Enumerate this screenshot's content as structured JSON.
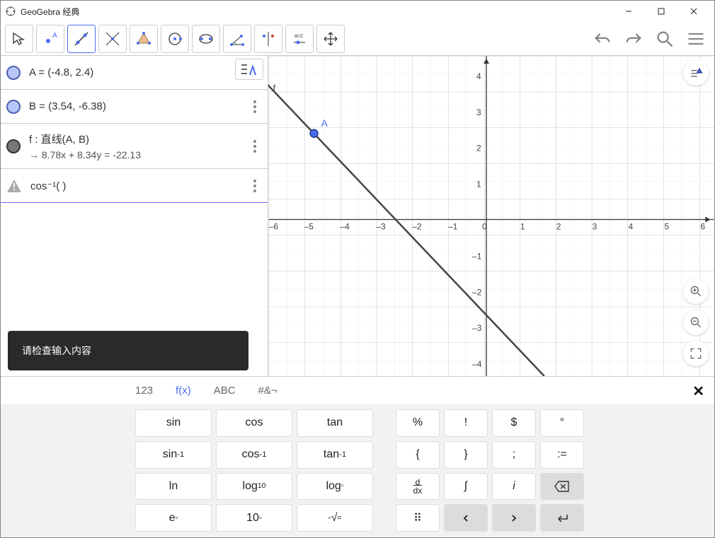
{
  "window": {
    "title": "GeoGebra 经典"
  },
  "algebra": {
    "rows": [
      {
        "label": "A = (-4.8, 2.4)"
      },
      {
        "label": "B = (3.54, -6.38)"
      },
      {
        "label": "f : 直线(A, B)",
        "sub": "→  8.78x + 8.34y = -22.13"
      },
      {
        "label": "cos⁻¹(   )"
      }
    ]
  },
  "tooltip": {
    "text": "请检查输入内容"
  },
  "graph": {
    "xticks": [
      "–6",
      "–5",
      "–4",
      "–3",
      "–2",
      "–1",
      "0",
      "1",
      "2",
      "3",
      "4",
      "5",
      "6"
    ],
    "yticks_pos": [
      "1",
      "2",
      "3",
      "4"
    ],
    "yticks_neg": [
      "–1",
      "–2",
      "–3",
      "–4"
    ],
    "pointA": "A",
    "fLabel": "f"
  },
  "keyboard": {
    "tabs": {
      "num": "123",
      "fx": "f(x)",
      "abc": "ABC",
      "sym": "#&¬"
    },
    "rows": [
      [
        "sin",
        "cos",
        "tan",
        "%",
        "!",
        "$",
        "°"
      ],
      [
        "sin⁻¹",
        "cos⁻¹",
        "tan⁻¹",
        "{",
        "}",
        ";",
        ":="
      ],
      [
        "ln",
        "log₁₀",
        "log_b",
        "d/dx",
        "∫",
        "i",
        "⌫"
      ],
      [
        "eˣ",
        "10ˣ",
        "ⁿ√",
        "⠿",
        "‹",
        "›",
        "↵"
      ]
    ]
  },
  "chart_data": {
    "type": "line",
    "title": "",
    "xlabel": "",
    "ylabel": "",
    "xlim": [
      -6.3,
      6.1
    ],
    "ylim": [
      -4.6,
      4.6
    ],
    "series": [
      {
        "name": "f",
        "equation": "8.78x + 8.34y = -22.13",
        "x": [
          -6.3,
          1.6
        ],
        "y": [
          3.98,
          -4.34
        ]
      }
    ],
    "points": [
      {
        "name": "A",
        "x": -4.8,
        "y": 2.4
      },
      {
        "name": "B",
        "x": 3.54,
        "y": -6.38
      }
    ]
  }
}
